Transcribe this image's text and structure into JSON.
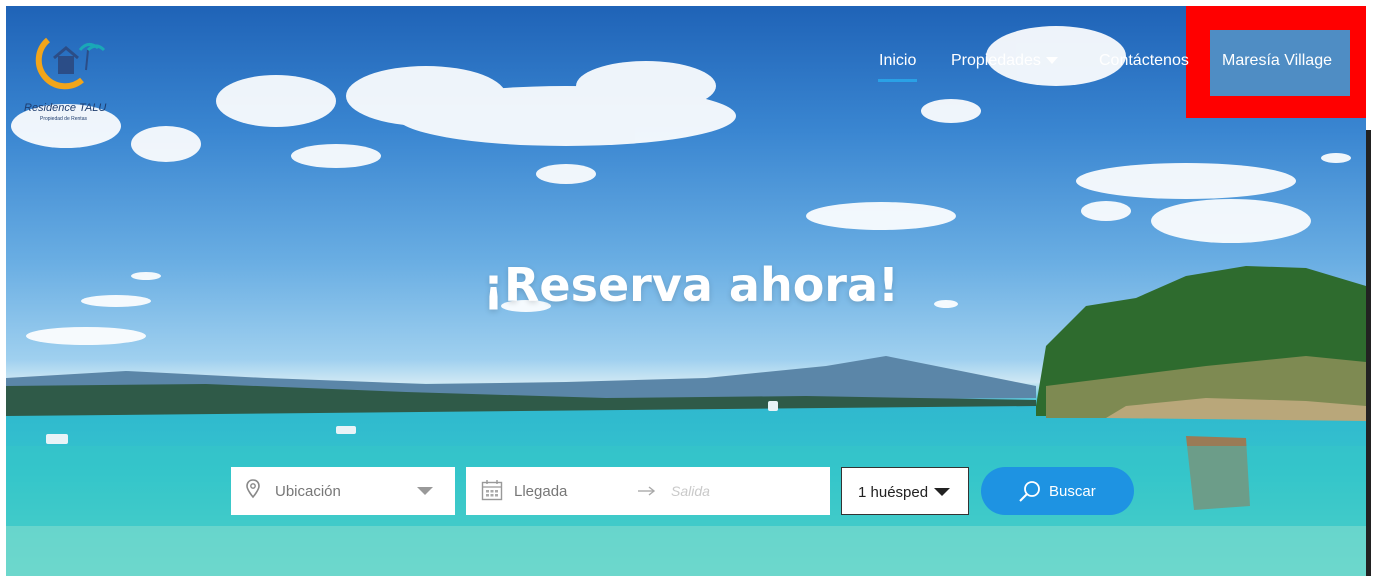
{
  "brand": {
    "logo_text": "Residence TALU",
    "logo_subtext": "Propiedad de Rentas"
  },
  "nav": {
    "items": [
      {
        "label": "Inicio",
        "active": true
      },
      {
        "label": "Propiedades",
        "has_dropdown": true
      },
      {
        "label": "Contáctenos"
      },
      {
        "label": "Maresía Village"
      }
    ]
  },
  "hero": {
    "headline": "¡Reserva ahora!"
  },
  "search": {
    "location_placeholder": "Ubicación",
    "checkin_placeholder": "Llegada",
    "checkout_placeholder": "Salida",
    "guests_value": "1 huésped",
    "search_label": "Buscar"
  },
  "colors": {
    "accent": "#1e93e2",
    "highlight": "#ff0000"
  },
  "icons": [
    "map-pin-icon",
    "calendar-icon",
    "arrow-right-icon",
    "caret-down-icon",
    "search-icon"
  ]
}
